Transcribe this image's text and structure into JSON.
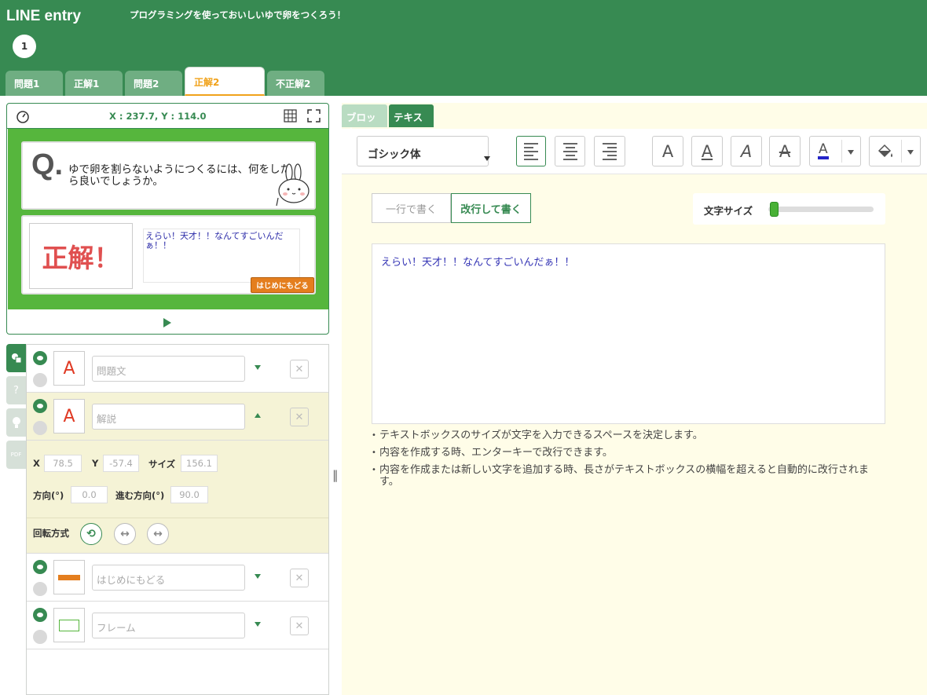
{
  "app": {
    "logo": "LINE entry",
    "project_title": "プログラミングを使っておいしいゆで卵をつくろう！",
    "stage_number": "1"
  },
  "scene_tabs": [
    {
      "label": "問題1"
    },
    {
      "label": "正解1"
    },
    {
      "label": "問題2"
    },
    {
      "label": "正解2",
      "active": true
    },
    {
      "label": "不正解2"
    }
  ],
  "stage": {
    "coordinates": "X : 237.7, Y : 114.0",
    "question_mark": "Q.",
    "question_text": "ゆで卵を割らないようにつくるには、何をしたら良いでしょうか。",
    "answer_label": "正解！",
    "answer_text": "えらい！天才！！なんてすごいんだぁ！！",
    "home_button": "はじめにもどる"
  },
  "sidebar_icons": [
    "objects-icon",
    "question-icon",
    "bulb-icon",
    "pdf-icon"
  ],
  "objects": [
    {
      "name": "問題文",
      "thumb": "A",
      "expanded": false
    },
    {
      "name": "解説",
      "thumb": "A",
      "expanded": true
    },
    {
      "name": "はじめにもどる",
      "thumb": "button",
      "expanded": false
    },
    {
      "name": "フレーム",
      "thumb": "frame",
      "expanded": false
    }
  ],
  "properties": {
    "x_label": "X",
    "x_value": "78.5",
    "y_label": "Y",
    "y_value": "-57.4",
    "size_label": "サイズ",
    "size_value": "156.1",
    "direction_label": "方向(°)",
    "direction_value": "0.0",
    "move_direction_label": "進む方向(°)",
    "move_direction_value": "90.0",
    "rotation_label": "回転方式"
  },
  "editor": {
    "tabs": [
      {
        "label": "ブロック"
      },
      {
        "label": "テキスト",
        "active": true
      }
    ],
    "font": "ゴシック体",
    "mode_single": "一行で書く",
    "mode_multi": "改行して書く",
    "size_label": "文字サイズ",
    "text_value": "えらい！天才！！なんてすごいんだぁ！！",
    "notes": [
      "テキストボックスのサイズが文字を入力できるスペースを決定します。",
      "内容を作成する時、エンターキーで改行できます。",
      "内容を作成または新しい文字を追加する時、長さがテキストボックスの横幅を超えると自動的に改行されます。"
    ],
    "text_color": "#2424c8",
    "accent": "#378a52"
  }
}
